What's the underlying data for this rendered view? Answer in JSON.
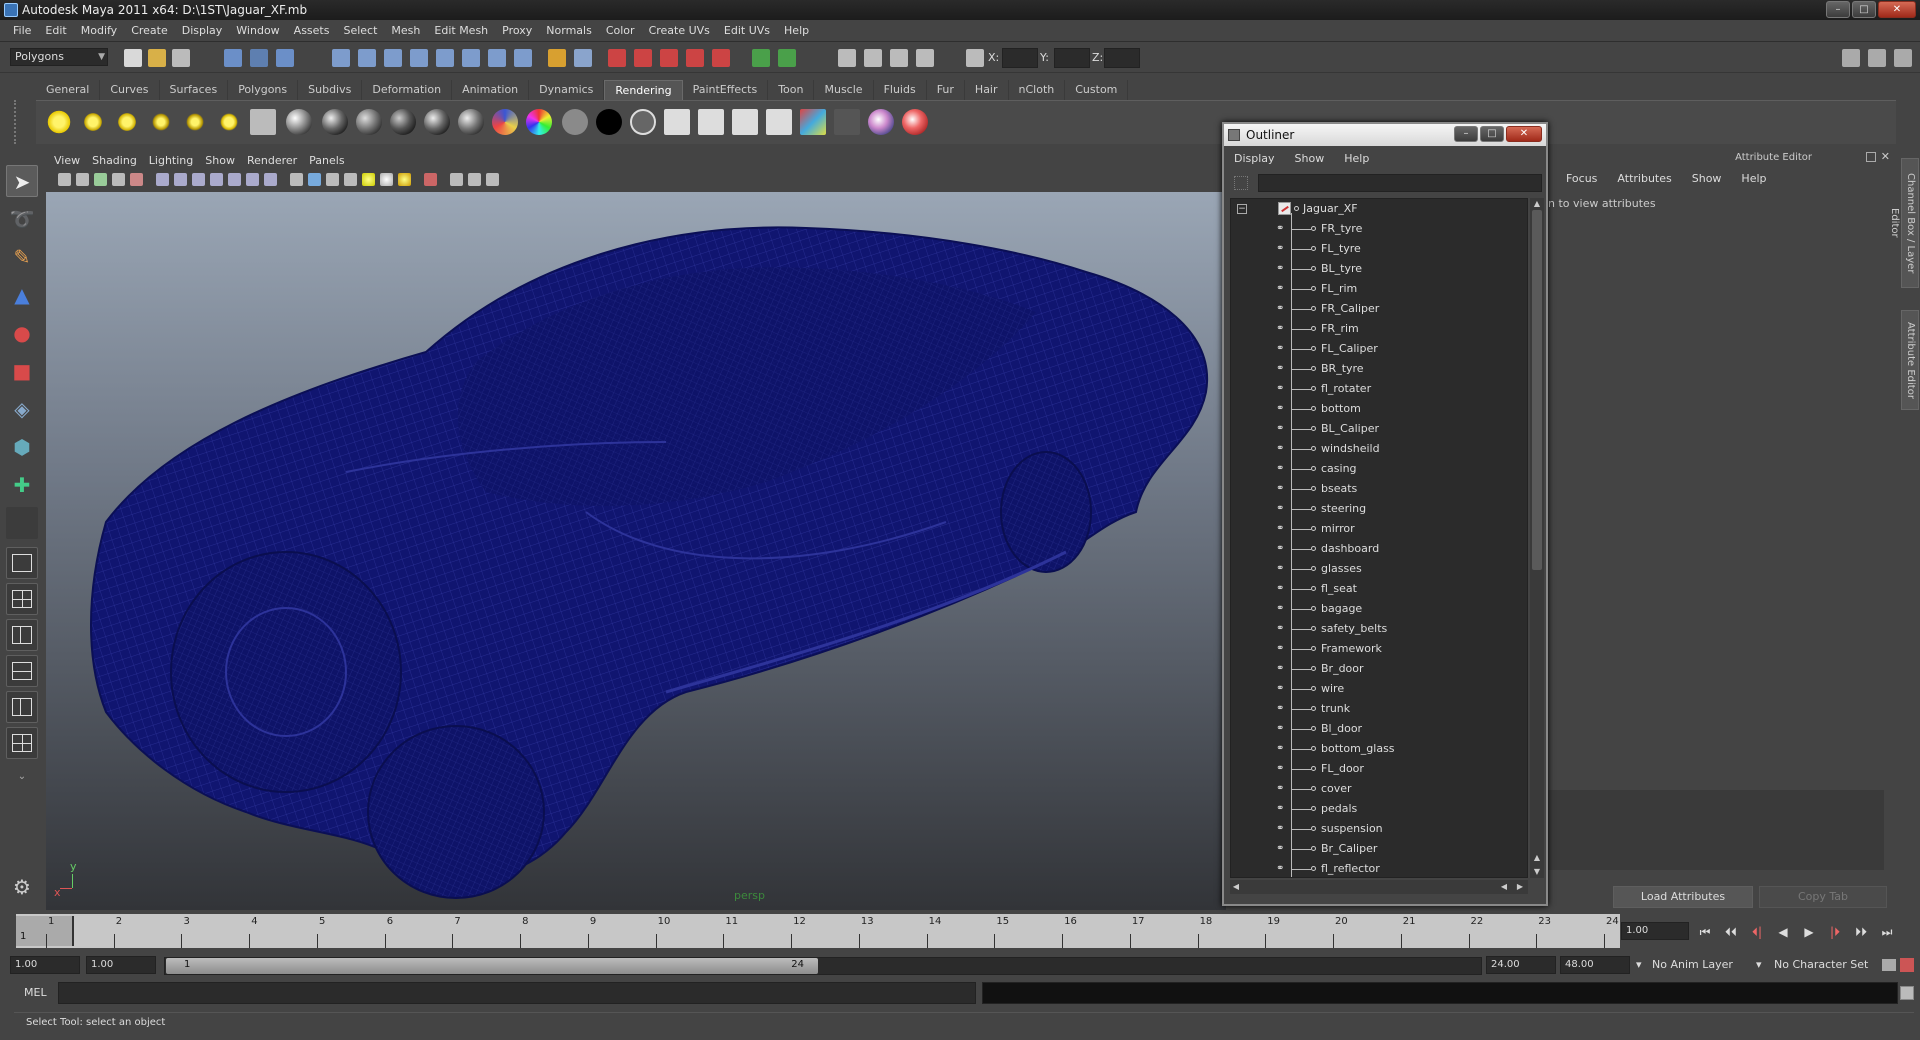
{
  "window": {
    "title": "Autodesk Maya 2011 x64: D:\\1ST\\Jaguar_XF.mb",
    "controls": {
      "minimize": "–",
      "maximize": "□",
      "close": "✕"
    }
  },
  "menubar": [
    "File",
    "Edit",
    "Modify",
    "Create",
    "Display",
    "Window",
    "Assets",
    "Select",
    "Mesh",
    "Edit Mesh",
    "Proxy",
    "Normals",
    "Color",
    "Create UVs",
    "Edit UVs",
    "Help"
  ],
  "status_line": {
    "mode": "Polygons",
    "coord_labels": {
      "x": "X:",
      "y": "Y:",
      "z": "Z:"
    }
  },
  "shelf": {
    "tabs": [
      "General",
      "Curves",
      "Surfaces",
      "Polygons",
      "Subdivs",
      "Deformation",
      "Animation",
      "Dynamics",
      "Rendering",
      "PaintEffects",
      "Toon",
      "Muscle",
      "Fluids",
      "Fur",
      "Hair",
      "nCloth",
      "Custom"
    ],
    "active_tab": "Rendering",
    "icons": [
      "ambient-light-icon",
      "directional-light-icon",
      "point-light-icon",
      "spot-light-icon",
      "area-light-icon",
      "volume-light-icon",
      "create-camera-icon",
      "lambert-sphere-icon",
      "blinn-sphere-icon",
      "phong-sphere-icon",
      "phonge-sphere-icon",
      "anisotropic-sphere-icon",
      "layered-shader-icon",
      "ramp-shader-icon",
      "surface-shader-icon",
      "use-background-icon",
      "black-sphere-icon",
      "gray-sphere-icon",
      "render-view-icon",
      "render-current-icon",
      "ipr-render-icon",
      "render-settings-icon",
      "hypershade-icon",
      "render-layer-icon",
      "paint-canvas-icon",
      "paint-effects-icon"
    ]
  },
  "viewport": {
    "menu": [
      "View",
      "Shading",
      "Lighting",
      "Show",
      "Renderer",
      "Panels"
    ],
    "camera_label": "persp",
    "axis": {
      "y": "y",
      "x": "x",
      "z": "z"
    }
  },
  "attribute_editor": {
    "title": "Attribute Editor",
    "menu": [
      "Focus",
      "Attributes",
      "Show",
      "Help"
    ],
    "hint": "n to view attributes",
    "buttons": {
      "load": "Load Attributes",
      "copy": "Copy Tab"
    },
    "side_tabs": [
      "Channel Box / Layer Editor",
      "Attribute Editor"
    ]
  },
  "outliner": {
    "title": "Outliner",
    "menu": [
      "Display",
      "Show",
      "Help"
    ],
    "root": "Jaguar_XF",
    "items": [
      "FR_tyre",
      "FL_tyre",
      "BL_tyre",
      "FL_rim",
      "FR_Caliper",
      "FR_rim",
      "FL_Caliper",
      "BR_tyre",
      "fl_rotater",
      "bottom",
      "BL_Caliper",
      "windsheild",
      "casing",
      "bseats",
      "steering",
      "mirror",
      "dashboard",
      "glasses",
      "fl_seat",
      "bagage",
      "safety_belts",
      "Framework",
      "Br_door",
      "wire",
      "trunk",
      "Bl_door",
      "bottom_glass",
      "FL_door",
      "cover",
      "pedals",
      "suspension",
      "Br_Caliper",
      "fl_reflector"
    ]
  },
  "time_slider": {
    "ticks": [
      "1",
      "2",
      "3",
      "4",
      "5",
      "6",
      "7",
      "8",
      "9",
      "10",
      "11",
      "12",
      "13",
      "14",
      "15",
      "16",
      "17",
      "18",
      "19",
      "20",
      "21",
      "22",
      "23",
      "24"
    ],
    "current_frame": "1",
    "current_time": "1.00",
    "playback_buttons": [
      "⏮",
      "⏴⏴",
      "⏴|",
      "◀",
      "▶",
      "|⏵",
      "⏵⏵",
      "⏭"
    ]
  },
  "range_slider": {
    "start_time": "1.00",
    "playback_start": "1.00",
    "range_start_label": "1",
    "range_end_label": "24",
    "playback_end": "24.00",
    "end_time": "48.00",
    "anim_layer": "No Anim Layer",
    "character_set": "No Character Set"
  },
  "command_line": {
    "label": "MEL"
  },
  "help_line": {
    "text": "Select Tool: select an object"
  },
  "colors": {
    "wireframe": "#0f1470",
    "wire_lines": "#2a2f8c",
    "grid": "#5a6070"
  }
}
